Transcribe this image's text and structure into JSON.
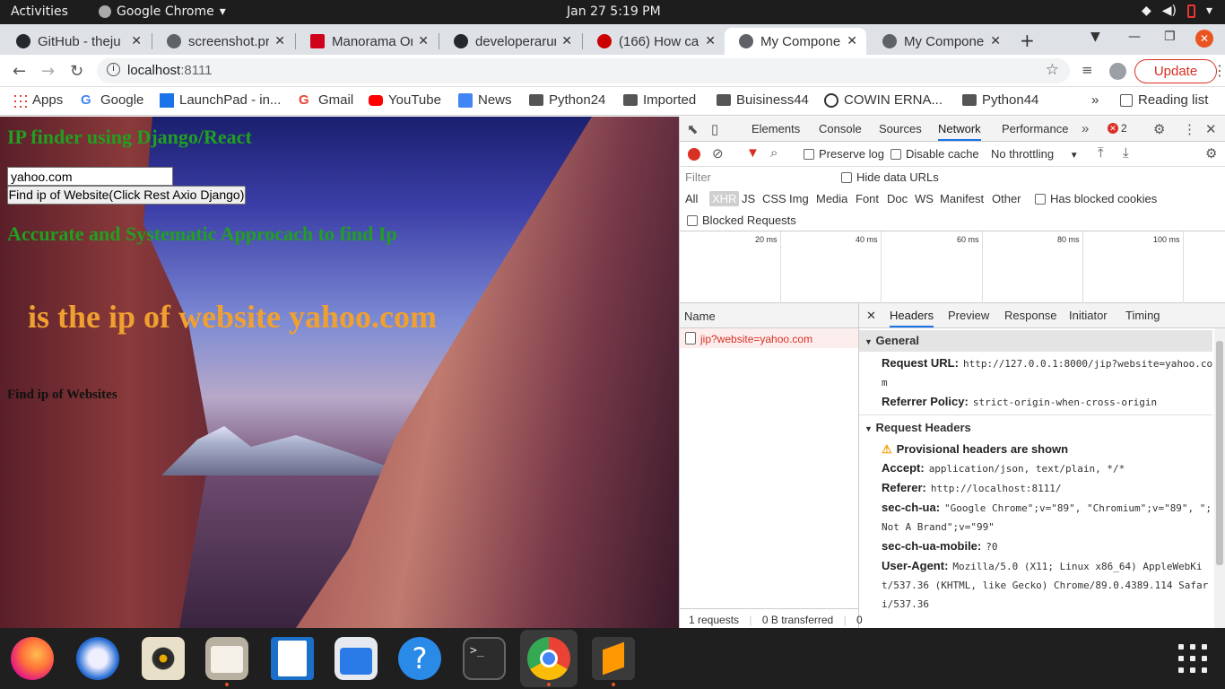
{
  "topbar": {
    "activities": "Activities",
    "app": "Google Chrome",
    "datetime": "Jan 27  5:19 PM"
  },
  "tabs": [
    {
      "title": "GitHub - theju",
      "color": "#24292e"
    },
    {
      "title": "screenshot.pr",
      "color": "#5f6368"
    },
    {
      "title": "Manorama Or",
      "color": "#d0021b"
    },
    {
      "title": "developerarun",
      "color": "#24292e"
    },
    {
      "title": "(166) How can",
      "color": "#cc0000"
    },
    {
      "title": "My Componen",
      "color": "#5f6368"
    },
    {
      "title": "My Componen",
      "color": "#5f6368"
    }
  ],
  "address": {
    "host": "localhost",
    "port": ":8111",
    "update": "Update"
  },
  "bookmarks": [
    "Apps",
    "Google",
    "LaunchPad - in...",
    "Gmail",
    "YouTube",
    "News",
    "Python24",
    "Imported",
    "Buisiness44",
    "COWIN ERNA...",
    "Python44",
    "Reading list"
  ],
  "page": {
    "title": "IP finder using Django/React",
    "input_value": "yahoo.com",
    "button": "Find ip of Website(Click Rest Axio Django)",
    "subtitle": "Accurate and Systematic Approcach to find Ip",
    "result": "is the ip of website yahoo.com",
    "footer": "Find ip of Websites"
  },
  "devtools": {
    "tabs": [
      "Elements",
      "Console",
      "Sources",
      "Network",
      "Performance"
    ],
    "error_count": "2",
    "preserve_log": "Preserve log",
    "disable_cache": "Disable cache",
    "throttling": "No throttling",
    "filter_placeholder": "Filter",
    "hide_data_urls": "Hide data URLs",
    "types": [
      "All",
      "XHR",
      "JS",
      "CSS",
      "Img",
      "Media",
      "Font",
      "Doc",
      "WS",
      "Manifest",
      "Other"
    ],
    "has_blocked_cookies": "Has blocked cookies",
    "blocked_requests": "Blocked Requests",
    "ticks": [
      "20 ms",
      "40 ms",
      "60 ms",
      "80 ms",
      "100 ms"
    ],
    "name_header": "Name",
    "request_name": "jip?website=yahoo.com",
    "footer_requests": "1 requests",
    "footer_transferred": "0 B transferred",
    "footer_extra": "0",
    "detail_tabs": [
      "Headers",
      "Preview",
      "Response",
      "Initiator",
      "Timing"
    ],
    "general": "General",
    "request_url_label": "Request URL:",
    "request_url": "http://127.0.0.1:8000/jip?website=yahoo.com",
    "referrer_policy_label": "Referrer Policy:",
    "referrer_policy": "strict-origin-when-cross-origin",
    "request_headers": "Request Headers",
    "provisional": "Provisional headers are shown",
    "accept_label": "Accept:",
    "accept": "application/json, text/plain, */*",
    "referer_label": "Referer:",
    "referer": "http://localhost:8111/",
    "sec_ch_ua_label": "sec-ch-ua:",
    "sec_ch_ua": "\"Google Chrome\";v=\"89\", \"Chromium\";v=\"89\", \";Not A Brand\";v=\"99\"",
    "sec_ch_ua_mobile_label": "sec-ch-ua-mobile:",
    "sec_ch_ua_mobile": "?0",
    "user_agent_label": "User-Agent:",
    "user_agent": "Mozilla/5.0 (X11; Linux x86_64) AppleWebKit/537.36 (KHTML, like Gecko) Chrome/89.0.4389.114 Safari/537.36"
  },
  "dock_icons": [
    "firefox-icon",
    "thunderbird-icon",
    "rhythmbox-icon",
    "files-icon",
    "writer-icon",
    "software-icon",
    "help-icon",
    "terminal-icon",
    "chrome-icon",
    "sublime-icon"
  ]
}
